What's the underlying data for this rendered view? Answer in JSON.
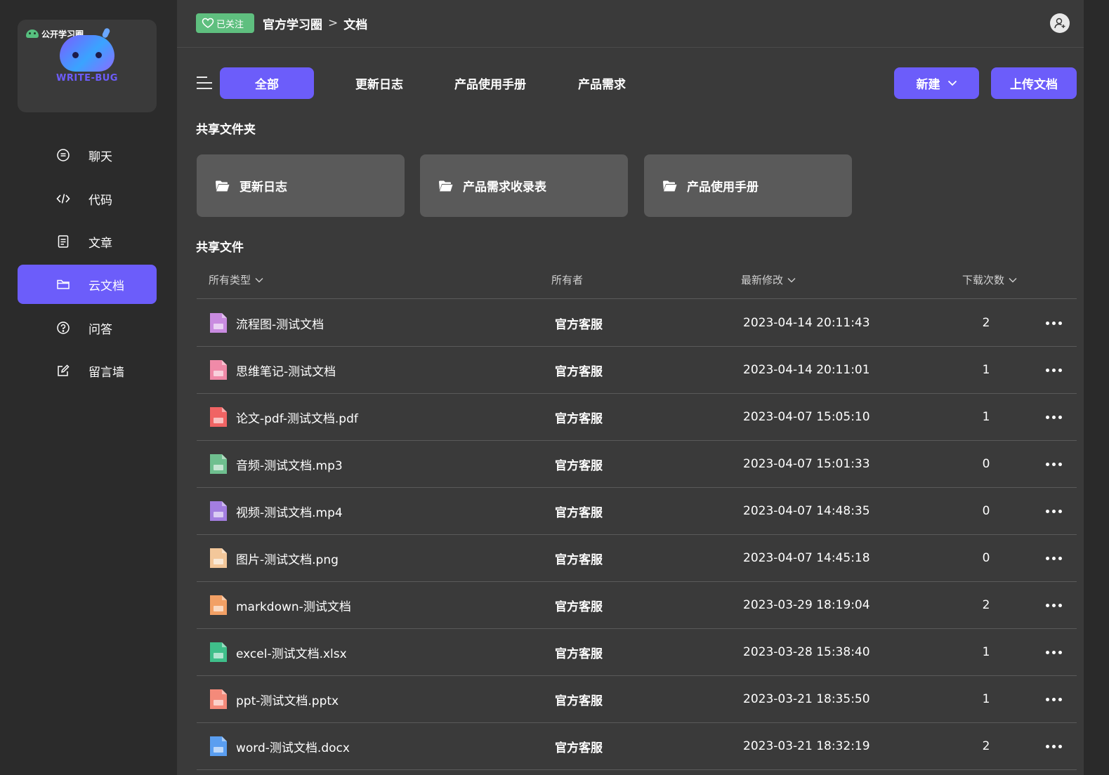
{
  "sidebar": {
    "logo": {
      "badge_text": "公开学习圈",
      "brand_text": "WRITE-BUG"
    },
    "items": [
      {
        "label": "聊天",
        "icon": "chat-icon",
        "active": false
      },
      {
        "label": "代码",
        "icon": "code-icon",
        "active": false
      },
      {
        "label": "文章",
        "icon": "article-icon",
        "active": false
      },
      {
        "label": "云文档",
        "icon": "folder-icon",
        "active": true
      },
      {
        "label": "问答",
        "icon": "question-icon",
        "active": false
      },
      {
        "label": "留言墙",
        "icon": "edit-icon",
        "active": false
      }
    ]
  },
  "header": {
    "follow_label": "已关注",
    "breadcrumb": [
      "官方学习圈",
      "文档"
    ],
    "breadcrumb_sep": ">"
  },
  "toolbar": {
    "tabs": [
      {
        "label": "全部",
        "active": true
      },
      {
        "label": "更新日志",
        "active": false
      },
      {
        "label": "产品使用手册",
        "active": false
      },
      {
        "label": "产品需求",
        "active": false
      }
    ],
    "new_label": "新建",
    "upload_label": "上传文档"
  },
  "shared_folders": {
    "title": "共享文件夹",
    "items": [
      "更新日志",
      "产品需求收录表",
      "产品使用手册"
    ]
  },
  "shared_files": {
    "title": "共享文件",
    "columns": {
      "type": "所有类型",
      "owner": "所有者",
      "modified": "最新修改",
      "downloads": "下载次数"
    },
    "rows": [
      {
        "name": "流程图-测试文档",
        "owner": "官方客服",
        "modified": "2023-04-14 20:11:43",
        "downloads": "2",
        "icon": "flowchart-file-icon",
        "color": "#c98be0"
      },
      {
        "name": "思维笔记-测试文档",
        "owner": "官方客服",
        "modified": "2023-04-14 20:11:01",
        "downloads": "1",
        "icon": "mindmap-file-icon",
        "color": "#f08aa8"
      },
      {
        "name": "论文-pdf-测试文档.pdf",
        "owner": "官方客服",
        "modified": "2023-04-07 15:05:10",
        "downloads": "1",
        "icon": "pdf-file-icon",
        "color": "#f06464"
      },
      {
        "name": "音频-测试文档.mp3",
        "owner": "官方客服",
        "modified": "2023-04-07 15:01:33",
        "downloads": "0",
        "icon": "audio-file-icon",
        "color": "#6fbf8f"
      },
      {
        "name": "视频-测试文档.mp4",
        "owner": "官方客服",
        "modified": "2023-04-07 14:48:35",
        "downloads": "0",
        "icon": "video-file-icon",
        "color": "#a37ee0"
      },
      {
        "name": "图片-测试文档.png",
        "owner": "官方客服",
        "modified": "2023-04-07 14:45:18",
        "downloads": "0",
        "icon": "image-file-icon",
        "color": "#f3c79a"
      },
      {
        "name": "markdown-测试文档",
        "owner": "官方客服",
        "modified": "2023-03-29 18:19:04",
        "downloads": "2",
        "icon": "markdown-file-icon",
        "color": "#f2a065"
      },
      {
        "name": "excel-测试文档.xlsx",
        "owner": "官方客服",
        "modified": "2023-03-28 15:38:40",
        "downloads": "1",
        "icon": "excel-file-icon",
        "color": "#3fbf8a"
      },
      {
        "name": "ppt-测试文档.pptx",
        "owner": "官方客服",
        "modified": "2023-03-21 18:35:50",
        "downloads": "1",
        "icon": "ppt-file-icon",
        "color": "#f48a7a"
      },
      {
        "name": "word-测试文档.docx",
        "owner": "官方客服",
        "modified": "2023-03-21 18:32:19",
        "downloads": "2",
        "icon": "word-file-icon",
        "color": "#5a9ef0"
      }
    ]
  },
  "colors": {
    "accent": "#6c5dfa",
    "follow_badge": "#5fbf7f",
    "sidebar_bg": "#2b2b2b",
    "main_bg": "#3a3a3a"
  }
}
